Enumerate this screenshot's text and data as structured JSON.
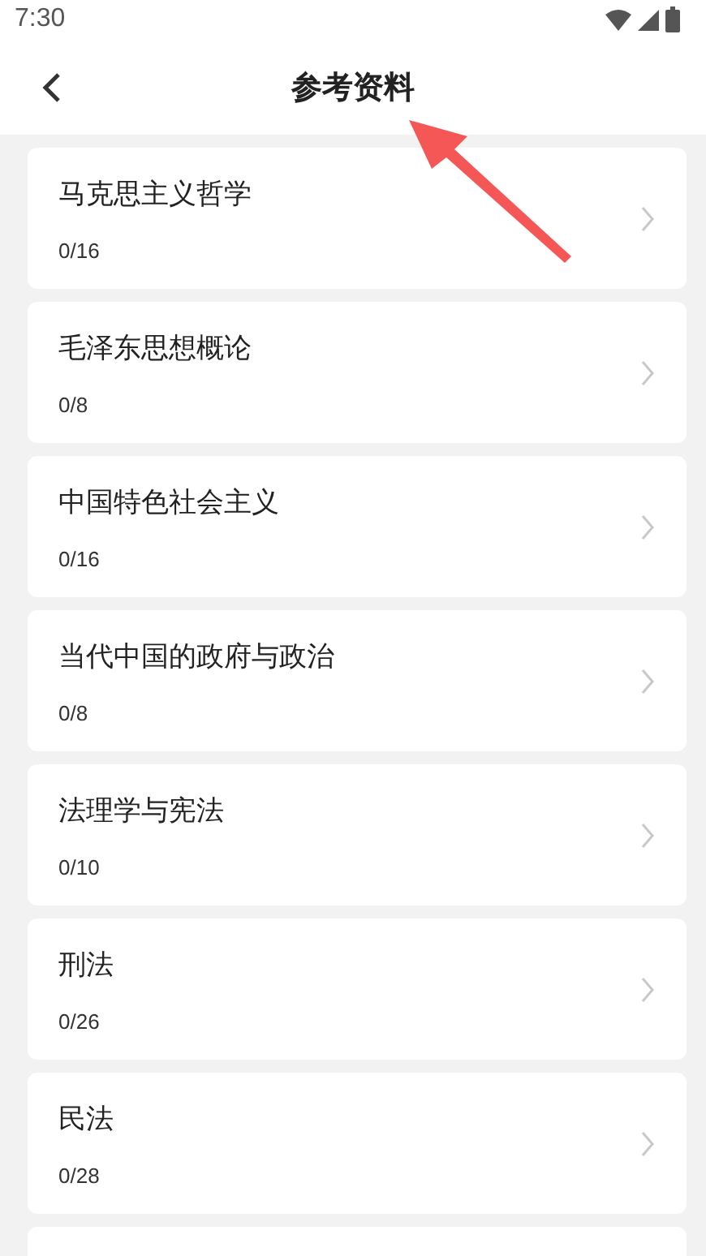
{
  "status_bar": {
    "time": "7:30"
  },
  "header": {
    "title": "参考资料"
  },
  "items": [
    {
      "title": "马克思主义哲学",
      "progress": "0/16"
    },
    {
      "title": "毛泽东思想概论",
      "progress": "0/8"
    },
    {
      "title": "中国特色社会主义",
      "progress": "0/16"
    },
    {
      "title": "当代中国的政府与政治",
      "progress": "0/8"
    },
    {
      "title": "法理学与宪法",
      "progress": "0/10"
    },
    {
      "title": "刑法",
      "progress": "0/26"
    },
    {
      "title": "民法",
      "progress": "0/28"
    }
  ]
}
